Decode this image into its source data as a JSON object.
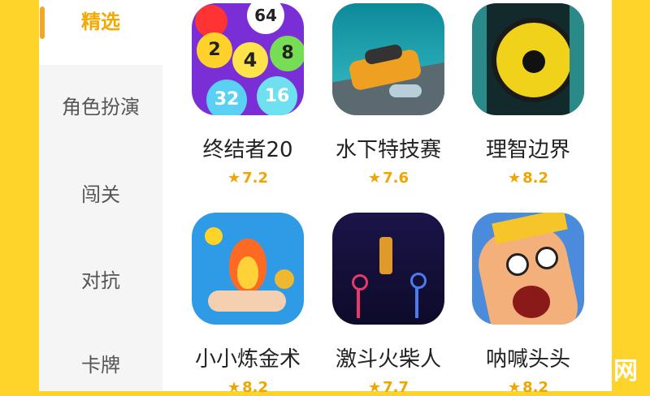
{
  "sidebar": {
    "items": [
      {
        "label": "精选"
      },
      {
        "label": "角色扮演"
      },
      {
        "label": "闯关"
      },
      {
        "label": "对抗"
      },
      {
        "label": "卡牌"
      }
    ]
  },
  "apps": [
    {
      "name": "终结者20",
      "rating": "7.2"
    },
    {
      "name": "水下特技赛",
      "rating": "7.6"
    },
    {
      "name": "理智边界",
      "rating": "8.2"
    },
    {
      "name": "小小炼金术",
      "rating": "8.2"
    },
    {
      "name": "激斗火柴人",
      "rating": "7.7"
    },
    {
      "name": "呐喊头头",
      "rating": "8.2"
    }
  ],
  "icon1_numbers": [
    "64",
    "2",
    "4",
    "8",
    "32",
    "16"
  ],
  "watermark": "网",
  "colors": {
    "accent": "#f5a623",
    "rating": "#f0a500",
    "background": "#ffd42a"
  }
}
